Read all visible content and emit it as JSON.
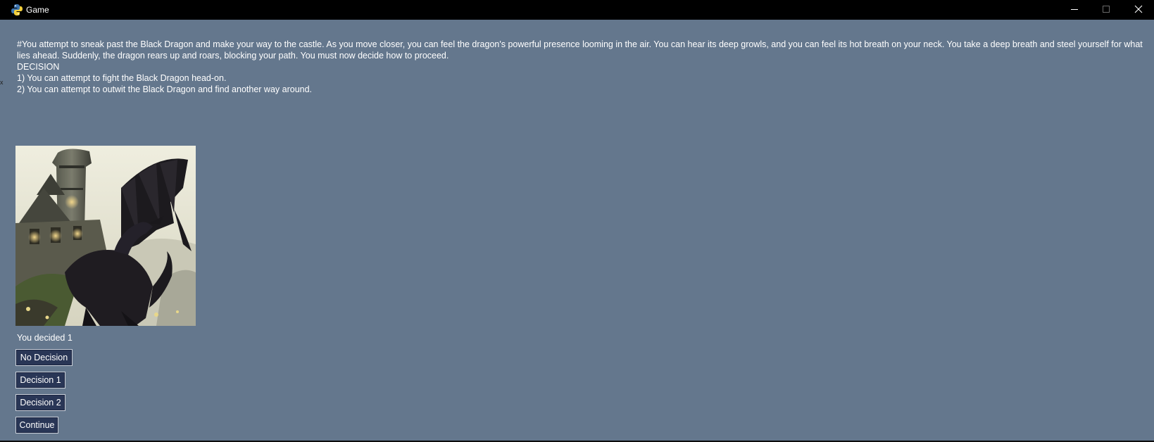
{
  "window": {
    "title": "Game",
    "icon": "python-icon"
  },
  "colors": {
    "background": "#64778d",
    "titlebar": "#000000",
    "button_bg": "#293656",
    "text": "#ffffff"
  },
  "story": {
    "narrative": "#You attempt to sneak past the Black Dragon and make your way to the castle. As you move closer, you can feel the dragon's powerful presence looming in the air. You can hear its deep growls, and you can feel its hot breath on your neck. You take a deep breath and steel yourself for what lies ahead. Suddenly, the dragon rears up and roars, blocking your path. You must now decide how to proceed.",
    "decision_heading": "DECISION",
    "option_1": "1) You can attempt to fight the Black Dragon head-on.",
    "option_2": "2) You can attempt to outwit the Black Dragon and find another way around."
  },
  "scene_image": {
    "subject": "black dragon before castle tower"
  },
  "result_text": "You decided 1",
  "buttons": {
    "no_decision": "No Decision",
    "decision_1": "Decision 1",
    "decision_2": "Decision 2",
    "continue": "Continue"
  }
}
